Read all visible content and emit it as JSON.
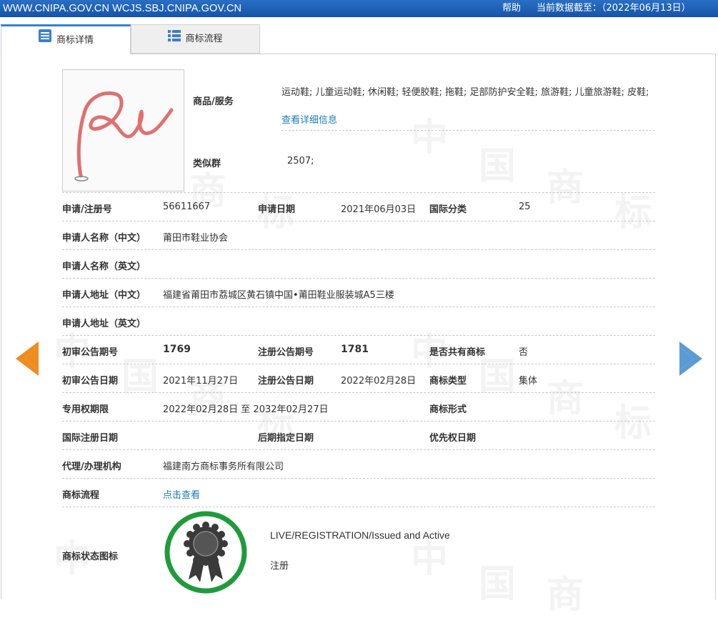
{
  "topbar": {
    "domains": "WWW.CNIPA.GOV.CN WCJS.SBJ.CNIPA.GOV.CN",
    "help": "帮助",
    "as_of": "当前数据截至：（2022年06月13日）"
  },
  "tabs": [
    {
      "label": "商标详情",
      "icon": "document-list-icon",
      "active": true
    },
    {
      "label": "商标流程",
      "icon": "list-icon",
      "active": false
    }
  ],
  "goods": {
    "label": "商品/服务",
    "text": "运动鞋; 儿童运动鞋; 休闲鞋; 轻便胶鞋; 拖鞋; 足部防护安全鞋; 旅游鞋; 儿童旅游鞋; 皮鞋;",
    "more_link": "查看详细信息"
  },
  "similar_group": {
    "label": "类似群",
    "value": "2507;"
  },
  "rows": {
    "reg_no_label": "申请/注册号",
    "reg_no": "56611667",
    "app_date_label": "申请日期",
    "app_date": "2021年06月03日",
    "intl_class_label": "国际分类",
    "intl_class": "25",
    "applicant_cn_label": "申请人名称（中文）",
    "applicant_cn": "莆田市鞋业协会",
    "applicant_en_label": "申请人名称（英文）",
    "address_cn_label": "申请人地址（中文）",
    "address_cn": "福建省莆田市荔城区黄石镇中国•莆田鞋业服装城A5三楼",
    "address_en_label": "申请人地址（英文）",
    "prelim_issue_label": "初审公告期号",
    "prelim_issue": "1769",
    "reg_issue_label": "注册公告期号",
    "reg_issue": "1781",
    "shared_label": "是否共有商标",
    "shared": "否",
    "prelim_date_label": "初审公告日期",
    "prelim_date": "2021年11月27日",
    "reg_date_label": "注册公告日期",
    "reg_date": "2022年02月28日",
    "type_label": "商标类型",
    "type": "集体",
    "term_label": "专用权期限",
    "term": "2022年02月28日 至 2032年02月27日",
    "form_label": "商标形式",
    "intl_reg_date_label": "国际注册日期",
    "later_date_label": "后期指定日期",
    "priority_label": "优先权日期",
    "agent_label": "代理/办理机构",
    "agent": "福建南方商标事务所有限公司",
    "flow_label": "商标流程",
    "flow_link": "点击查看",
    "status_label": "商标状态图标",
    "status_en": "LIVE/REGISTRATION/Issued and Active",
    "status_cn": "注册"
  },
  "colors": {
    "topbar": "#1a5fb4",
    "link": "#1a7fb5",
    "prev_arrow": "#f08c1e",
    "next_arrow": "#5b9bd5",
    "badge_ring": "#1e9b3a",
    "tm_stroke": "#e07070"
  },
  "icons": {
    "prev": "prev-arrow-icon",
    "next": "next-arrow-icon",
    "status": "ribbon-award-icon"
  }
}
